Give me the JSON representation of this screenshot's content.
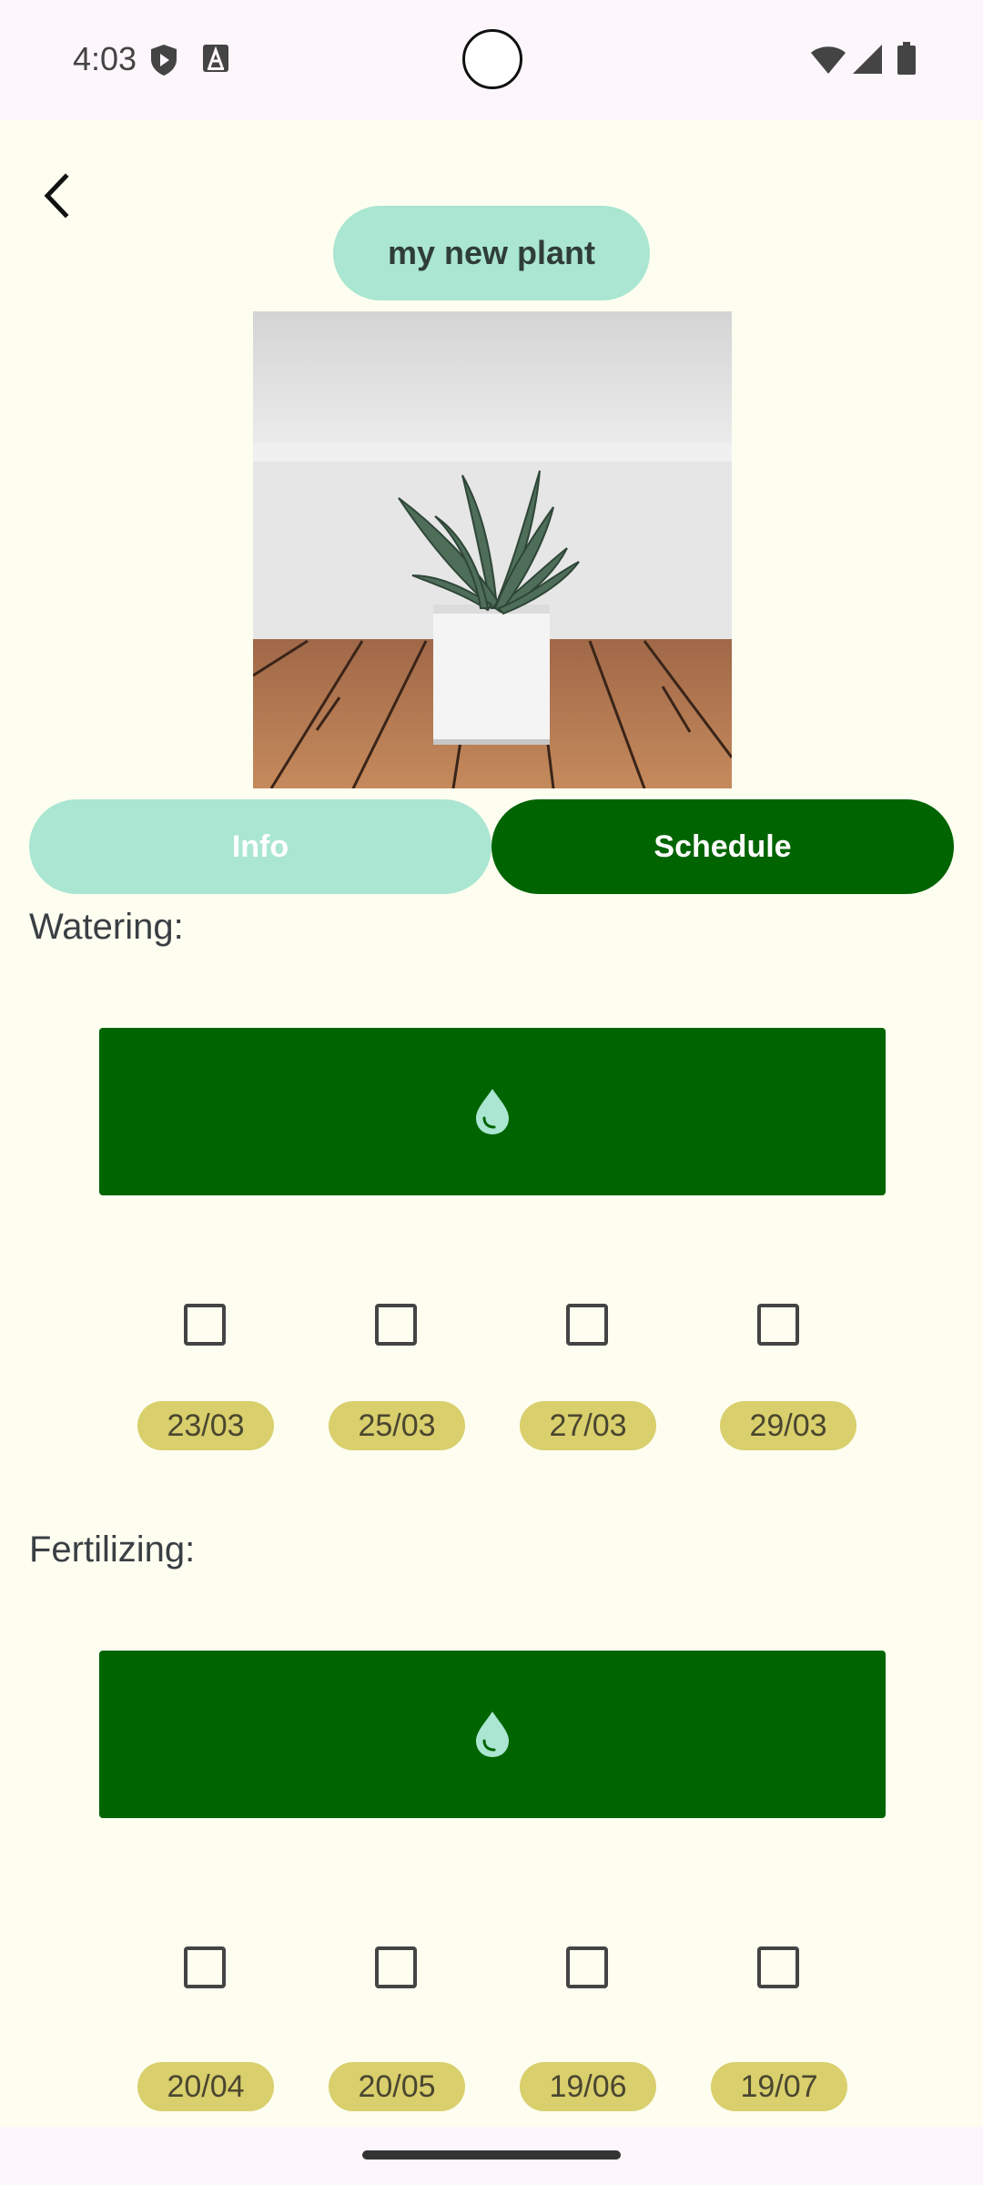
{
  "status_bar": {
    "time": "4:03",
    "icons": [
      "play-protect-icon",
      "text-a-icon",
      "wifi-icon",
      "signal-icon",
      "battery-icon"
    ]
  },
  "header": {
    "back_icon": "arrow-back-icon",
    "title": "my new plant"
  },
  "tabs": [
    {
      "label": "Info",
      "selected": false
    },
    {
      "label": "Schedule",
      "selected": true
    }
  ],
  "watering": {
    "label": "Watering:",
    "button_icon": "water-drop-icon",
    "checks": [
      false,
      false,
      false,
      false
    ],
    "dates": [
      "23/03",
      "25/03",
      "27/03",
      "29/03"
    ]
  },
  "fertilizing": {
    "label": "Fertilizing:",
    "button_icon": "water-drop-icon",
    "checks": [
      false,
      false,
      false,
      false
    ],
    "dates": [
      "20/04",
      "20/05",
      "19/06",
      "19/07"
    ]
  },
  "colors": {
    "background": "#fdfef0",
    "primary": "#006400",
    "mint": "#aae6d1",
    "chip": "#d9cf6c"
  }
}
